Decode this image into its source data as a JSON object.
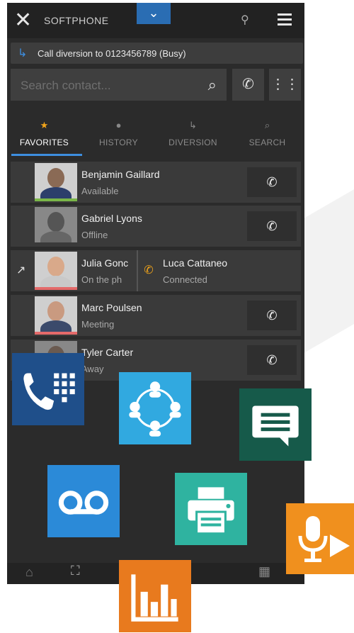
{
  "app": {
    "title": "SOFTPHONE",
    "close_icon": "close-icon",
    "menu_icon": "hamburger-icon"
  },
  "diversion_banner": {
    "text": "Call diversion to 0123456789 (Busy)"
  },
  "search": {
    "placeholder": "Search contact..."
  },
  "tabs": [
    {
      "label": "FAVORITES",
      "icon": "star-icon",
      "active": true
    },
    {
      "label": "HISTORY",
      "icon": "clock-icon",
      "active": false
    },
    {
      "label": "DIVERSION",
      "icon": "diversion-icon",
      "active": false
    },
    {
      "label": "SEARCH",
      "icon": "search-icon",
      "active": false
    }
  ],
  "contacts": [
    {
      "name": "Benjamin Gaillard",
      "status": "Available",
      "status_color": "#7ab648"
    },
    {
      "name": "Gabriel Lyons",
      "status": "Offline",
      "status_color": "#3a3a3a"
    },
    {
      "name": "Julia Gonc",
      "status": "On the ph",
      "status_color": "#e46a6a",
      "transfer_name": "Luca Cattaneo",
      "transfer_status": "Connected"
    },
    {
      "name": "Marc Poulsen",
      "status": "Meeting",
      "status_color": "#e46a6a"
    },
    {
      "name": "Tyler Carter",
      "status": "Away",
      "status_color": "#3a3a3a"
    }
  ],
  "feature_tiles": [
    {
      "name": "phone-dialpad-tile",
      "color": "#1f4f8a"
    },
    {
      "name": "network-people-tile",
      "color": "#31a9e0"
    },
    {
      "name": "chat-tile",
      "color": "#165a4a"
    },
    {
      "name": "voicemail-tile",
      "color": "#2b8ad8"
    },
    {
      "name": "fax-printer-tile",
      "color": "#2fb3a0"
    },
    {
      "name": "voice-record-tile",
      "color": "#f0901e"
    },
    {
      "name": "stats-tile",
      "color": "#e87a1e"
    }
  ]
}
